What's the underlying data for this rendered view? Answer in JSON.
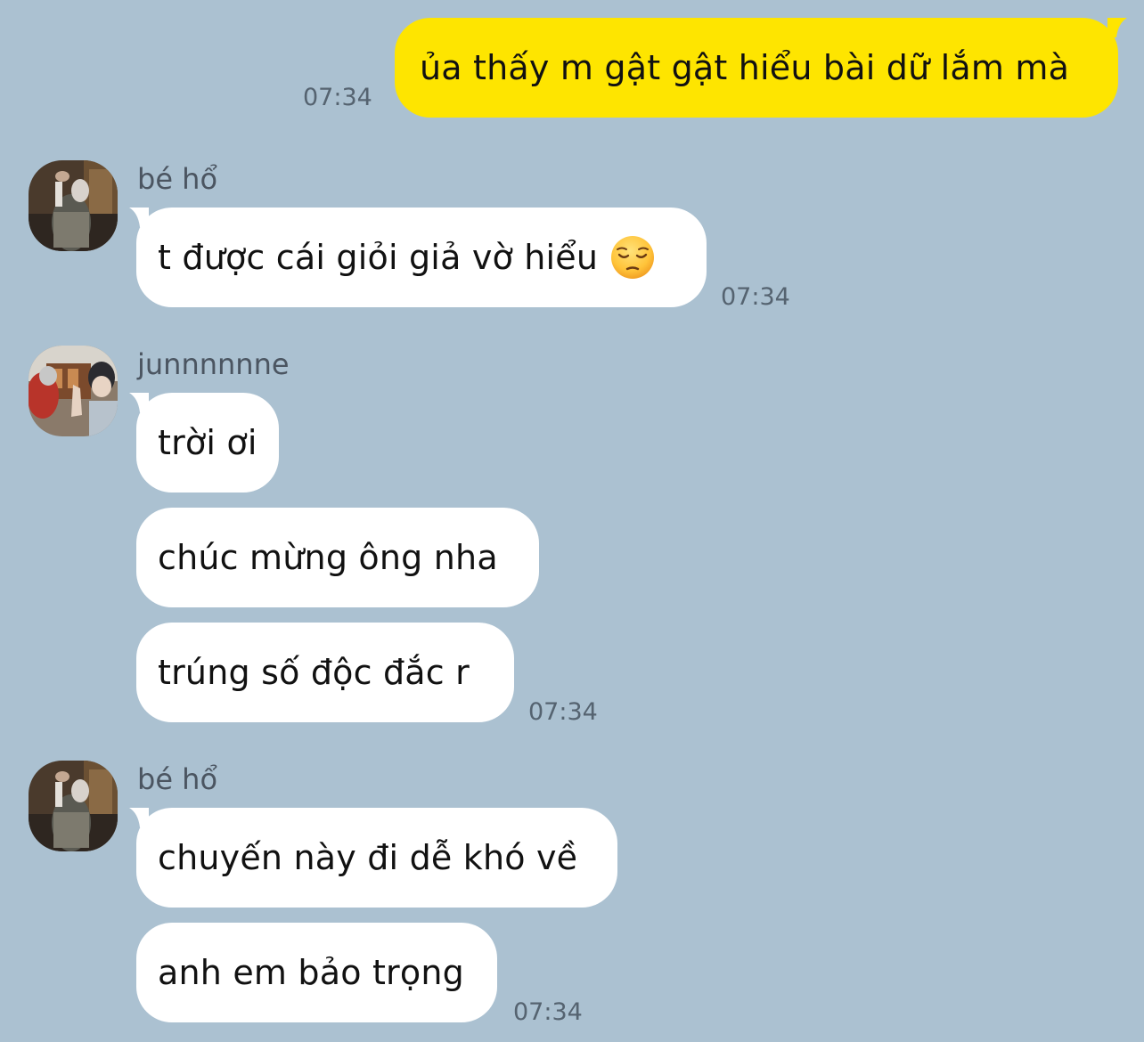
{
  "messages": {
    "m1": {
      "text": "ủa thấy m gật gật hiểu bài dữ lắm mà",
      "time": "07:34"
    },
    "m2": {
      "sender": "bé hổ",
      "text": "t được cái giỏi giả vờ hiểu",
      "emoji": "pensive-face",
      "time": "07:34"
    },
    "m3": {
      "sender": "junnnnnne",
      "lines": [
        "trời ơi",
        "chúc mừng ông nha",
        "trúng số độc đắc r"
      ],
      "time": "07:34"
    },
    "m4": {
      "sender": "bé hổ",
      "lines": [
        "chuyến này đi dễ khó về",
        "anh em bảo trọng"
      ],
      "time": "07:34"
    }
  },
  "colors": {
    "background": "#abc1d1",
    "outgoing_bubble": "#fee500",
    "incoming_bubble": "#ffffff",
    "timestamp": "#556370",
    "sender_name": "#4b5561"
  }
}
